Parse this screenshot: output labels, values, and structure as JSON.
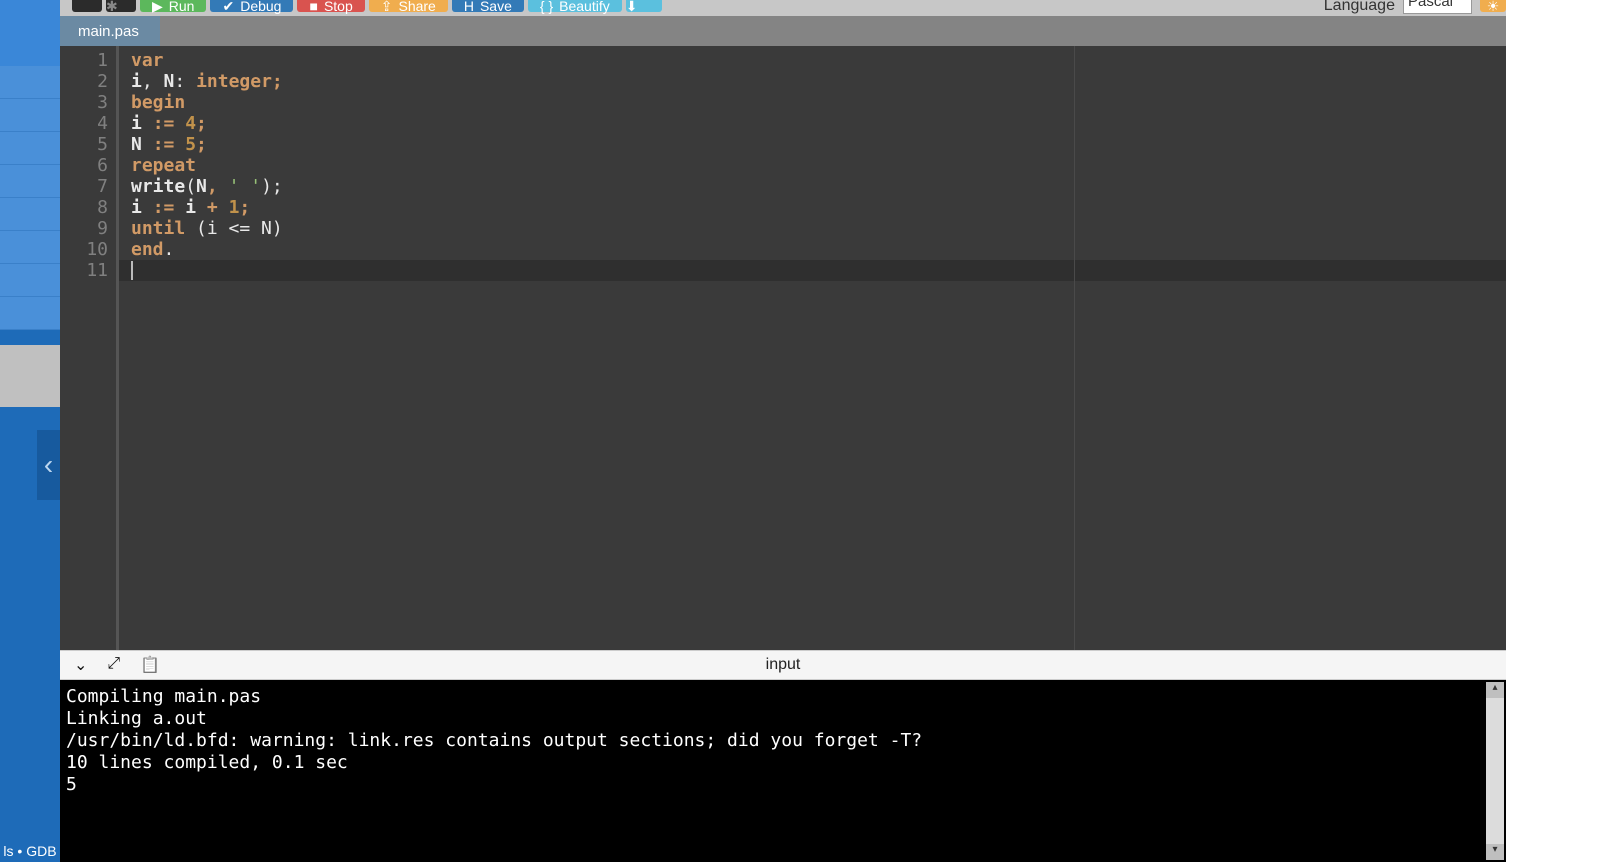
{
  "toolbar": {
    "run_label": "Run",
    "debug_label": "Debug",
    "stop_label": "Stop",
    "share_label": "Share",
    "save_label": "Save",
    "beautify_label": "Beautify",
    "language_label": "Language",
    "language_selected": "Pascal"
  },
  "tab": {
    "filename": "main.pas"
  },
  "editor": {
    "line_numbers": [
      "1",
      "2",
      "3",
      "4",
      "5",
      "6",
      "7",
      "8",
      "9",
      "10",
      "11"
    ],
    "lines": [
      [
        {
          "t": "var",
          "c": "kw"
        }
      ],
      [
        {
          "t": "i",
          "c": "id"
        },
        {
          "t": ", ",
          "c": "op"
        },
        {
          "t": "N",
          "c": "id"
        },
        {
          "t": ": ",
          "c": "op"
        },
        {
          "t": "integer",
          "c": "kw"
        },
        {
          "t": ";",
          "c": "pc"
        }
      ],
      [
        {
          "t": "begin",
          "c": "kw"
        }
      ],
      [
        {
          "t": "i ",
          "c": "id"
        },
        {
          "t": ":= ",
          "c": "pc"
        },
        {
          "t": "4",
          "c": "num"
        },
        {
          "t": ";",
          "c": "pc"
        }
      ],
      [
        {
          "t": "N ",
          "c": "id"
        },
        {
          "t": ":= ",
          "c": "pc"
        },
        {
          "t": "5",
          "c": "num"
        },
        {
          "t": ";",
          "c": "pc"
        }
      ],
      [
        {
          "t": "repeat",
          "c": "kw"
        }
      ],
      [
        {
          "t": "write",
          "c": "id"
        },
        {
          "t": "(",
          "c": "op"
        },
        {
          "t": "N",
          "c": "id"
        },
        {
          "t": ", ",
          "c": "pc"
        },
        {
          "t": "' '",
          "c": "str"
        },
        {
          "t": ");",
          "c": "op"
        }
      ],
      [
        {
          "t": "i ",
          "c": "id"
        },
        {
          "t": ":= ",
          "c": "pc"
        },
        {
          "t": "i ",
          "c": "id"
        },
        {
          "t": "+ ",
          "c": "pc"
        },
        {
          "t": "1",
          "c": "num"
        },
        {
          "t": ";",
          "c": "pc"
        }
      ],
      [
        {
          "t": "until",
          "c": "kw"
        },
        {
          "t": " (i <= N)",
          "c": "op"
        }
      ],
      [
        {
          "t": "end",
          "c": "kw"
        },
        {
          "t": ".",
          "c": "op"
        }
      ],
      []
    ],
    "current_line_index": 10
  },
  "inputbar": {
    "label": "input"
  },
  "console": {
    "lines": [
      "Compiling main.pas",
      "Linking a.out",
      "/usr/bin/ld.bfd: warning: link.res contains output sections; did you forget -T?",
      "10 lines compiled, 0.1 sec",
      "5 "
    ]
  },
  "footer": {
    "text": "ls • GDB"
  },
  "icons": {
    "chevron_left": "‹",
    "chevron_down": "⌄",
    "expand": "⤢",
    "clipboard": "📋",
    "sun": "☀",
    "gear": "⚙",
    "play": "▶",
    "check": "✔",
    "square": "■",
    "share": "⇪",
    "save": "💾",
    "braces": "{ }",
    "download": "⬇"
  }
}
